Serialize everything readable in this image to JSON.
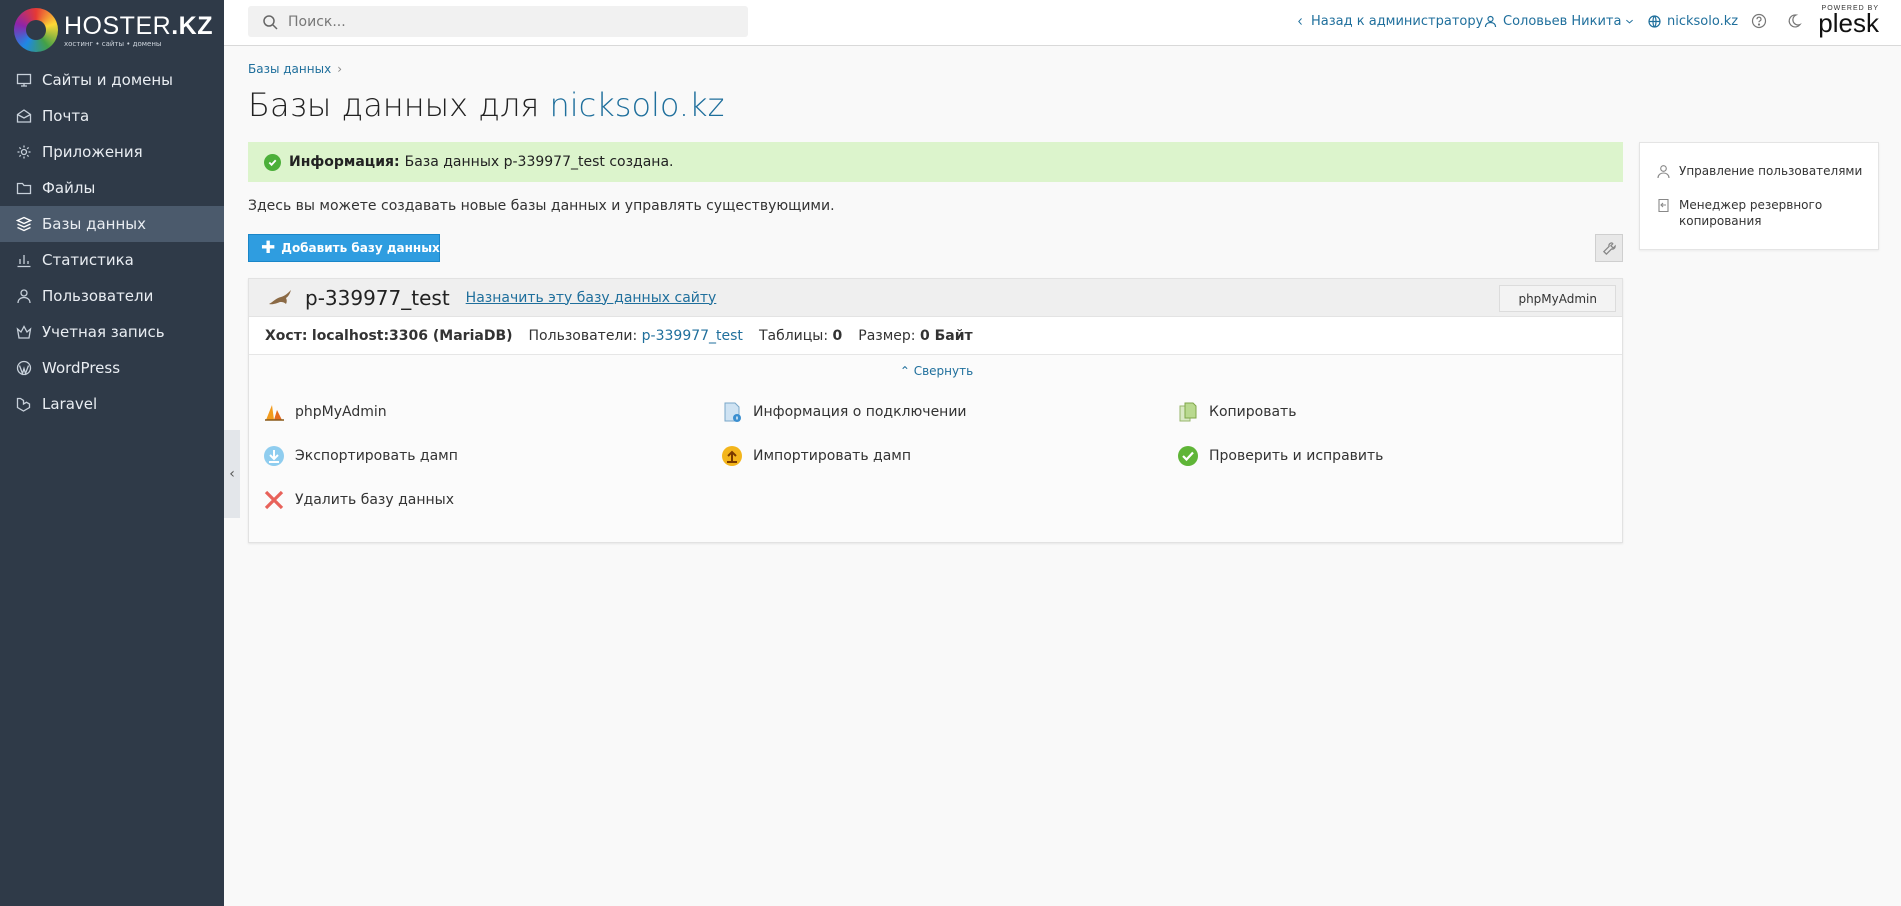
{
  "logo": {
    "brand": "HOSTER",
    "brand_suffix": ".KZ",
    "tagline": "хостинг • сайты • домены"
  },
  "sidebar": {
    "items": [
      {
        "label": "Сайты и домены",
        "icon": "monitor-icon"
      },
      {
        "label": "Почта",
        "icon": "mail-icon"
      },
      {
        "label": "Приложения",
        "icon": "gear-icon"
      },
      {
        "label": "Файлы",
        "icon": "folder-icon"
      },
      {
        "label": "Базы данных",
        "icon": "database-layers-icon",
        "active": true
      },
      {
        "label": "Статистика",
        "icon": "bar-chart-icon"
      },
      {
        "label": "Пользователи",
        "icon": "user-icon"
      },
      {
        "label": "Учетная запись",
        "icon": "crown-icon"
      },
      {
        "label": "WordPress",
        "icon": "wordpress-icon"
      },
      {
        "label": "Laravel",
        "icon": "laravel-icon"
      }
    ]
  },
  "header": {
    "search_placeholder": "Поиск...",
    "back_to_admin": "Назад к администратору",
    "user_name": "Соловьев Никита",
    "domain": "nicksolo.kz",
    "powered_by": "POWERED BY",
    "plesk": "plesk"
  },
  "main": {
    "breadcrumb": "Базы данных",
    "title_prefix": "Базы данных для",
    "title_domain": "nicksolo.kz",
    "message_label": "Информация:",
    "message_text": "База данных p-339977_test создана.",
    "intro": "Здесь вы можете создавать новые базы данных и управлять существующими.",
    "add_button": "Добавить базу данных"
  },
  "database": {
    "name": "p-339977_test",
    "assign_link": "Назначить эту базу данных сайту",
    "phpmyadmin_button": "phpMyAdmin",
    "host_label": "Хост:",
    "host_value": "localhost:3306 (MariaDB)",
    "users_label": "Пользователи:",
    "users_value": "p-339977_test",
    "tables_label": "Таблицы:",
    "tables_value": "0",
    "size_label": "Размер:",
    "size_value": "0 Байт",
    "collapse_label": "Свернуть",
    "actions": {
      "phpmyadmin": "phpMyAdmin",
      "connection_info": "Информация о подключении",
      "copy": "Копировать",
      "export_dump": "Экспортировать дамп",
      "import_dump": "Импортировать дамп",
      "check_repair": "Проверить и исправить",
      "delete_db": "Удалить базу данных"
    }
  },
  "side_panel": {
    "user_management": "Управление пользователями",
    "backup_manager": "Менеджер резервного копирования"
  },
  "colors": {
    "sidebar_bg": "#2f3a48",
    "accent": "#2f9de0",
    "link": "#1f6f9c",
    "success_bg": "#dcf4cc"
  }
}
